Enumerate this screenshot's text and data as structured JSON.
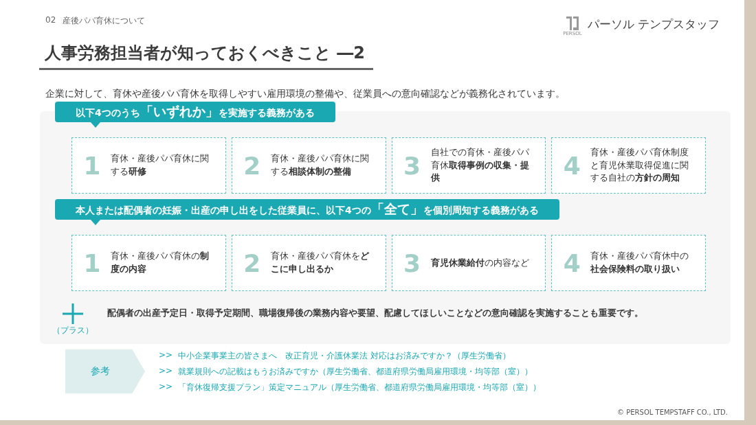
{
  "header": {
    "section_number": "02",
    "section_title": "産後パパ育休について"
  },
  "logo": {
    "mark_caption": "PERSOL",
    "name": "パーソル テンプスタッフ"
  },
  "title": "人事労務担当者が知っておくべきこと ―2",
  "intro": "企業に対して、育休や産後パパ育休を取得しやすい雇用環境の整備や、従業員への意向確認などが義務化されています。",
  "groups": [
    {
      "banner": {
        "lead": "以下4つのうち",
        "emphasis": "「いずれか」",
        "tail": "を実施する義務がある"
      },
      "items": [
        {
          "number": "1",
          "text": "育休・産後パパ育休に関する**研修**"
        },
        {
          "number": "2",
          "text": "育休・産後パパ育休に関する**相談体制の整備**"
        },
        {
          "number": "3",
          "text": "自社での育休・産後パパ育休**取得事例の収集・提供**"
        },
        {
          "number": "4",
          "text": "育休・産後パパ育休制度と育児休業取得促進に関する自社の**方針の周知**"
        }
      ]
    },
    {
      "banner": {
        "lead": "本人または配偶者の妊娠・出産の申し出をした従業員に、以下4つの",
        "emphasis": "「全て」",
        "tail": "を個別周知する義務がある"
      },
      "items": [
        {
          "number": "1",
          "text": "育休・産後パパ育休の**制度の内容**"
        },
        {
          "number": "2",
          "text": "育休・産後パパ育休を**どこに申し出るか**"
        },
        {
          "number": "3",
          "text": "**育児休業給付**の内容など"
        },
        {
          "number": "4",
          "text": "育休・産後パパ育休中の**社会保険料の取り扱い**"
        }
      ]
    }
  ],
  "plus": {
    "caption": "（プラス）",
    "text": "配偶者の出産予定日・取得予定期間、職場復帰後の業務内容や要望、配慮してほしいことなどの意向確認を実施することも重要です。"
  },
  "reference": {
    "label": "参考",
    "links": [
      {
        "marker": ">>",
        "text": "中小企業事業主の皆さまへ　改正育児・介護休業法 対応はお済みですか？（厚生労働省）"
      },
      {
        "marker": ">>",
        "text": "就業規則への記載はもうお済みですか（厚生労働省、都道府県労働局雇用環境・均等部（室））"
      },
      {
        "marker": ">>",
        "text": "「育休復帰支援プラン」策定マニュアル（厚生労働省、都道府県労働局雇用環境・均等部（室））"
      }
    ]
  },
  "copyright": "© PERSOL TEMPSTAFF CO., LTD."
}
